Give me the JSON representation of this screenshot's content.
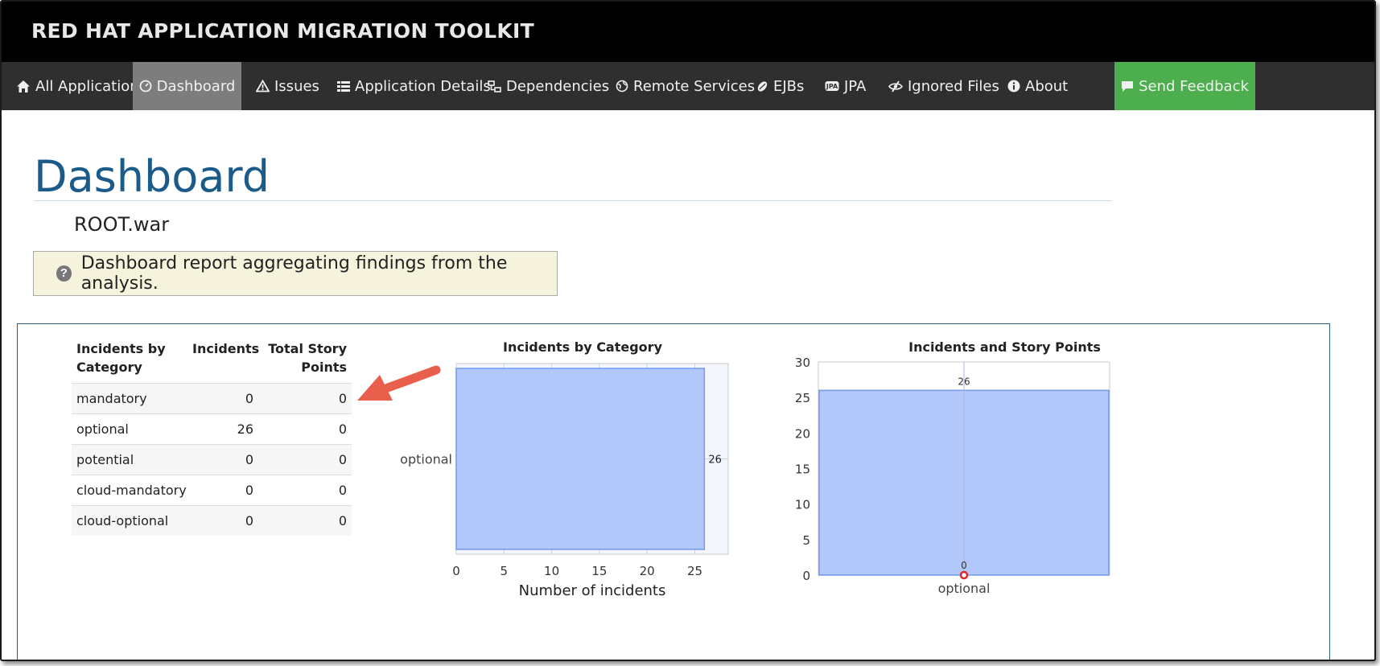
{
  "brand": {
    "title": "RED HAT APPLICATION MIGRATION TOOLKIT"
  },
  "nav": {
    "items": [
      {
        "label": "All Applications",
        "icon": "home-icon"
      },
      {
        "label": "Dashboard",
        "icon": "dashboard-icon",
        "active": true
      },
      {
        "label": "Issues",
        "icon": "warning-icon"
      },
      {
        "label": "Application Details",
        "icon": "list-icon"
      },
      {
        "label": "Dependencies",
        "icon": "dependencies-icon"
      },
      {
        "label": "Remote Services",
        "icon": "globe-icon"
      },
      {
        "label": "EJBs",
        "icon": "bean-icon"
      },
      {
        "label": "JPA",
        "icon": "jpa-icon"
      },
      {
        "label": "Ignored Files",
        "icon": "eye-slash-icon"
      },
      {
        "label": "About",
        "icon": "info-circle-icon"
      }
    ],
    "feedback": {
      "label": "Send Feedback",
      "icon": "comment-icon"
    }
  },
  "page": {
    "title": "Dashboard",
    "subtitle": "ROOT.war",
    "info": "Dashboard report aggregating findings from the analysis.",
    "info_icon": "?"
  },
  "incidents_table": {
    "headers": {
      "category_line1": "Incidents by",
      "category_line2": "Category",
      "incidents": "Incidents",
      "points_line1": "Total Story",
      "points_line2": "Points"
    },
    "rows": [
      {
        "category": "mandatory",
        "incidents": "0",
        "points": "0"
      },
      {
        "category": "optional",
        "incidents": "26",
        "points": "0"
      },
      {
        "category": "potential",
        "incidents": "0",
        "points": "0"
      },
      {
        "category": "cloud-mandatory",
        "incidents": "0",
        "points": "0"
      },
      {
        "category": "cloud-optional",
        "incidents": "0",
        "points": "0"
      }
    ]
  },
  "colors": {
    "brand_bg": "#000000",
    "nav_bg": "#2f2f2f",
    "nav_active": "#7d7d7d",
    "feedback": "#4cae4c",
    "title": "#1a5b8a",
    "bar_fill": "#b3c8fa",
    "bar_stroke": "#7398f0",
    "arrow": "#e8604c"
  },
  "chart_data": [
    {
      "type": "bar",
      "orientation": "horizontal",
      "title": "Incidents by Category",
      "categories": [
        "optional"
      ],
      "values": [
        26
      ],
      "data_labels": [
        "26"
      ],
      "xlabel": "Number of incidents",
      "ylabel": "",
      "xlim": [
        0,
        28.5
      ],
      "xticks": [
        0,
        5,
        10,
        15,
        20,
        25
      ],
      "grid": true
    },
    {
      "type": "bar",
      "title": "Incidents and Story Points",
      "categories": [
        "optional"
      ],
      "series": [
        {
          "values": [
            26
          ],
          "labels": [
            "26"
          ],
          "kind": "bar"
        },
        {
          "values": [
            0
          ],
          "labels": [
            "0"
          ],
          "kind": "point"
        }
      ],
      "ylim": [
        0,
        30
      ],
      "yticks": [
        0,
        5,
        10,
        15,
        20,
        25,
        30
      ],
      "grid": true
    }
  ]
}
